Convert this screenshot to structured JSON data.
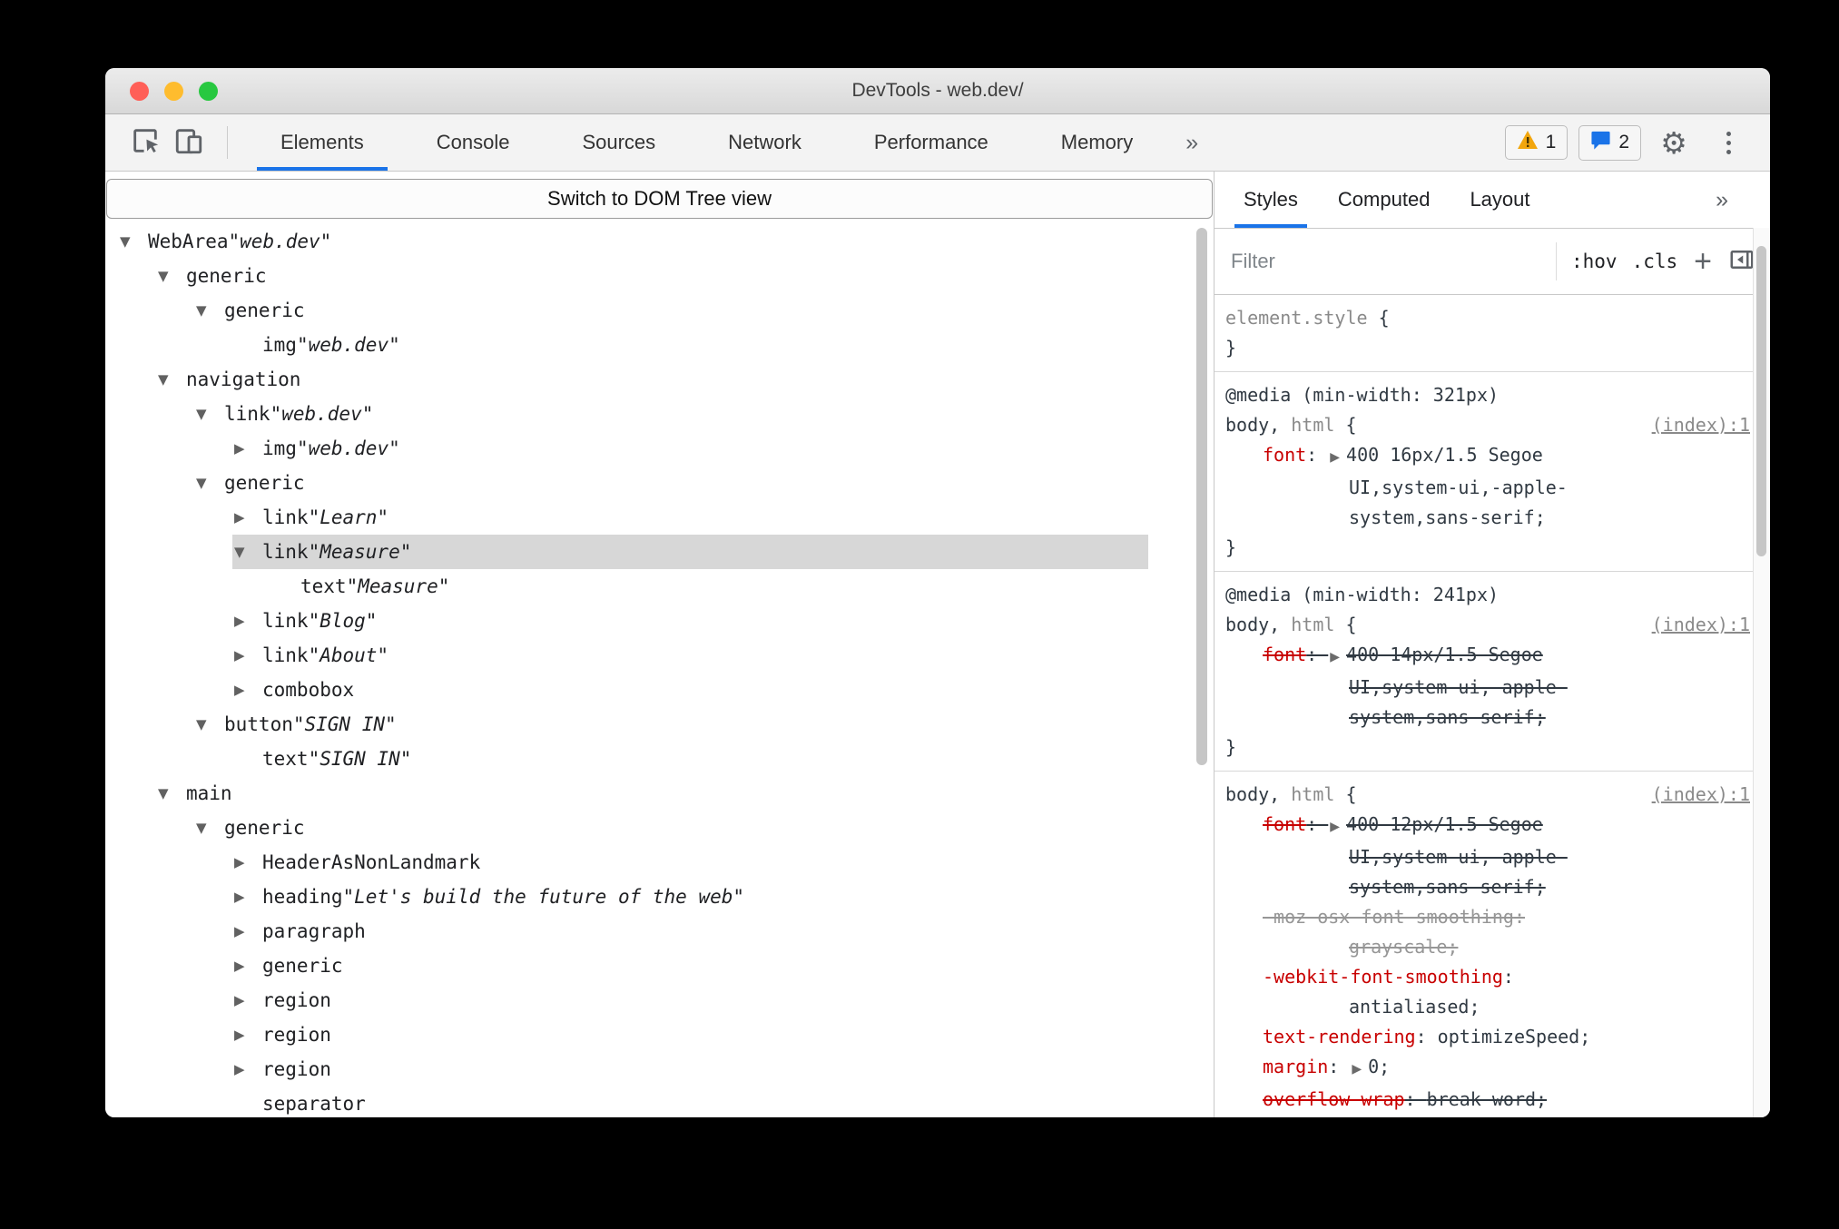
{
  "colors": {
    "accent": "#1a73e8",
    "css_property": "#c80000",
    "selection_background": "#d7d7d7",
    "warning_yellow": "#f2a60d",
    "message_blue": "#1a73e8"
  },
  "icons": {
    "inspect": "inspect-cursor-icon",
    "device_toolbar": "device-toolbar-icon",
    "warning": "warning-triangle-icon",
    "messages": "message-bubble-icon",
    "settings": "gear-icon",
    "overflow_menu": "vertical-dots-icon",
    "sidebar_toggle": "sidebar-toggle-icon"
  },
  "window": {
    "title": "DevTools - web.dev/"
  },
  "toolbar": {
    "tabs": [
      "Elements",
      "Console",
      "Sources",
      "Network",
      "Performance",
      "Memory"
    ],
    "active_tab": "Elements",
    "overflow_label": "»",
    "warning_count": "1",
    "message_count": "2"
  },
  "dom_banner": {
    "label": "Switch to DOM Tree view"
  },
  "a11y_tree": {
    "rows": [
      {
        "level": 0,
        "state": "expanded",
        "role": "WebArea",
        "value": "web.dev"
      },
      {
        "level": 1,
        "state": "expanded",
        "role": "generic"
      },
      {
        "level": 2,
        "state": "expanded",
        "role": "generic"
      },
      {
        "level": 3,
        "state": "leaf",
        "role": "img",
        "value": "web.dev"
      },
      {
        "level": 1,
        "state": "expanded",
        "role": "navigation"
      },
      {
        "level": 2,
        "state": "expanded",
        "role": "link",
        "value": "web.dev"
      },
      {
        "level": 3,
        "state": "collapsed",
        "role": "img",
        "value": "web.dev"
      },
      {
        "level": 2,
        "state": "expanded",
        "role": "generic"
      },
      {
        "level": 3,
        "state": "collapsed",
        "role": "link",
        "value": "Learn"
      },
      {
        "level": 3,
        "state": "expanded",
        "role": "link",
        "value": "Measure",
        "selected": true
      },
      {
        "level": 4,
        "state": "leaf",
        "role": "text",
        "value": "Measure"
      },
      {
        "level": 3,
        "state": "collapsed",
        "role": "link",
        "value": "Blog"
      },
      {
        "level": 3,
        "state": "collapsed",
        "role": "link",
        "value": "About"
      },
      {
        "level": 3,
        "state": "collapsed",
        "role": "combobox"
      },
      {
        "level": 2,
        "state": "expanded",
        "role": "button",
        "value": "SIGN IN"
      },
      {
        "level": 3,
        "state": "leaf",
        "role": "text",
        "value": "SIGN IN"
      },
      {
        "level": 1,
        "state": "expanded",
        "role": "main"
      },
      {
        "level": 2,
        "state": "expanded",
        "role": "generic"
      },
      {
        "level": 3,
        "state": "collapsed",
        "role": "HeaderAsNonLandmark"
      },
      {
        "level": 3,
        "state": "collapsed",
        "role": "heading",
        "value": "Let's build the future of the web"
      },
      {
        "level": 3,
        "state": "collapsed",
        "role": "paragraph"
      },
      {
        "level": 3,
        "state": "collapsed",
        "role": "generic"
      },
      {
        "level": 3,
        "state": "collapsed",
        "role": "region"
      },
      {
        "level": 3,
        "state": "collapsed",
        "role": "region"
      },
      {
        "level": 3,
        "state": "collapsed",
        "role": "region"
      },
      {
        "level": 3,
        "state": "leaf",
        "role": "separator"
      }
    ]
  },
  "styles_panel": {
    "tabs": [
      "Styles",
      "Computed",
      "Layout"
    ],
    "active_tab": "Styles",
    "overflow_label": "»",
    "filter_placeholder": "Filter",
    "pseudo_toggle": ":hov",
    "class_toggle": ".cls",
    "add_label": "+",
    "sections": [
      {
        "selector_parts": [
          {
            "text": "element.style ",
            "kind": "dim"
          },
          {
            "text": "{",
            "kind": "plain"
          }
        ],
        "source_link": null,
        "declarations": [],
        "close_brace": "}"
      },
      {
        "at_rule": "@media (min-width: 321px)",
        "selector_parts": [
          {
            "text": "body, ",
            "kind": "plain"
          },
          {
            "text": "html",
            "kind": "dim"
          },
          {
            "text": " {",
            "kind": "plain"
          }
        ],
        "source_link": "(index):1",
        "declarations": [
          {
            "property": "font",
            "expand_arrow": true,
            "struck": false,
            "dim": false,
            "value_lines": [
              "400 16px/1.5 Segoe",
              "UI,system-ui,-apple-",
              "system,sans-serif;"
            ]
          }
        ],
        "close_brace": "}"
      },
      {
        "at_rule": "@media (min-width: 241px)",
        "selector_parts": [
          {
            "text": "body, ",
            "kind": "plain"
          },
          {
            "text": "html",
            "kind": "dim"
          },
          {
            "text": " {",
            "kind": "plain"
          }
        ],
        "source_link": "(index):1",
        "declarations": [
          {
            "property": "font",
            "expand_arrow": true,
            "struck": true,
            "dim": false,
            "value_lines": [
              "400 14px/1.5 Segoe",
              "UI,system-ui,-apple-",
              "system,sans-serif;"
            ]
          }
        ],
        "close_brace": "}"
      },
      {
        "selector_parts": [
          {
            "text": "body, ",
            "kind": "plain"
          },
          {
            "text": "html",
            "kind": "dim"
          },
          {
            "text": " {",
            "kind": "plain"
          }
        ],
        "source_link": "(index):1",
        "declarations": [
          {
            "property": "font",
            "expand_arrow": true,
            "struck": true,
            "dim": false,
            "value_lines": [
              "400 12px/1.5 Segoe",
              "UI,system-ui, apple-",
              "system,sans-serif;"
            ]
          },
          {
            "property": "-moz-osx-font-smoothing",
            "expand_arrow": false,
            "struck": true,
            "dim": true,
            "value_lines": [
              "",
              "grayscale;"
            ]
          },
          {
            "property": "-webkit-font-smoothing",
            "expand_arrow": false,
            "struck": false,
            "dim": false,
            "value_lines": [
              "",
              "antialiased;"
            ]
          },
          {
            "property": "text-rendering",
            "expand_arrow": false,
            "struck": false,
            "dim": false,
            "value_lines": [
              "optimizeSpeed;"
            ]
          },
          {
            "property": "margin",
            "expand_arrow": true,
            "struck": false,
            "dim": false,
            "value_lines": [
              "0;"
            ]
          },
          {
            "property": "overflow-wrap",
            "expand_arrow": false,
            "struck": true,
            "dim": false,
            "value_lines": [
              "break-word;"
            ]
          }
        ],
        "close_brace": "}"
      }
    ]
  }
}
